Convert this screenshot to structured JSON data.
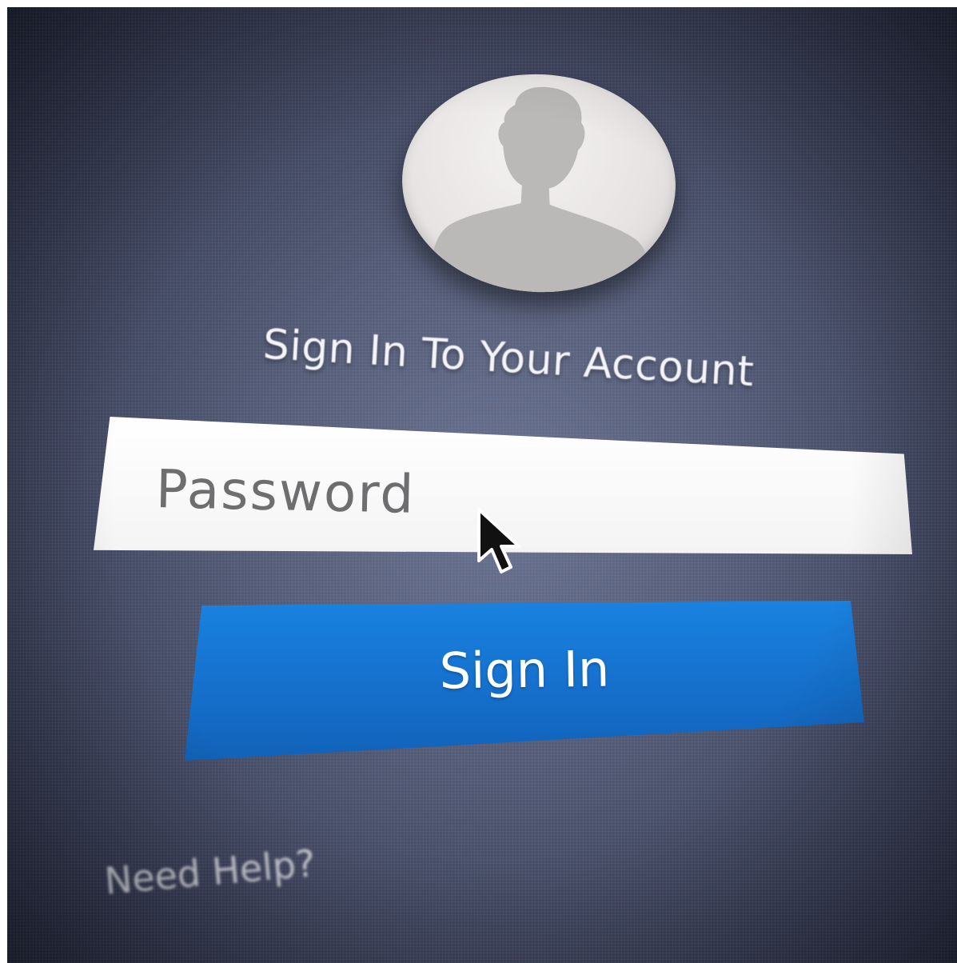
{
  "login": {
    "title": "Sign In To Your Account",
    "password_placeholder": "Password",
    "sign_in_label": "Sign In",
    "help_link": "Need Help?"
  },
  "icons": {
    "avatar": "user-silhouette-icon",
    "cursor": "mouse-pointer-icon"
  },
  "colors": {
    "background": "#555d78",
    "primary_button": "#1570cc",
    "input_background": "#ffffff",
    "avatar_background": "#e6e3e2",
    "silhouette": "#b9b6b6",
    "title_text": "#f4f5f8",
    "placeholder_text": "#6e6e70"
  }
}
